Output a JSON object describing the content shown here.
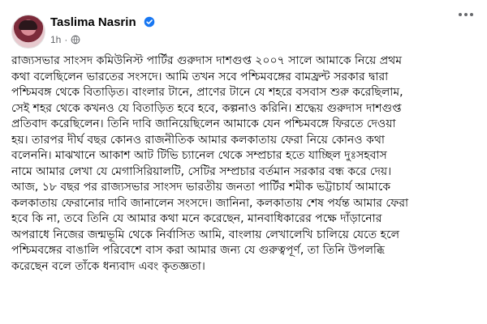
{
  "post": {
    "author_name": "Taslima Nasrin",
    "verified_badge": "verified-badge-icon",
    "timestamp": "1h",
    "privacy_icon": "globe-icon",
    "menu_icon": "more-options-icon",
    "lines": [
      "রাজ্যসভার সাংসদ কমিউনিস্ট পার্টির গুরুদাস দাশগুপ্ত  ২০০৭ সালে আমাকে নিয়ে প্রথম",
      "কথা বলেছিলেন ভারতের সংসদে। আমি তখন  সবে পশ্চিমবঙ্গের  বামফ্রন্ট সরকার দ্বারা",
      "পশ্চিমবঙ্গ থেকে বিতাড়িত। বাংলার টানে, প্রাণের টানে যে শহরে বসবাস শুরু করেছিলাম,",
      "সেই শহর থেকে কখনও যে বিতাড়িত হবে হবে, কল্পনাও করিনি। শ্রদ্ধেয় গুরুদাস দাশগুপ্ত",
      "প্রতিবাদ করেছিলেন। তিনি দাবি জানিয়েছিলেন আমাকে যেন পশ্চিমবঙ্গে ফিরতে দেওয়া",
      "হয়। তারপর দীর্ঘ বছর কোনও রাজনীতিক আমার কলকাতায় ফেরা নিয়ে কোনও কথা",
      "বলেননি। মাঝখানে  আকাশ আট টিভি চ্যানেল থেকে সম্প্রচার হতে যাচ্ছিল   দুঃসহবাস",
      "নামে আমার লেখা যে মেগাসিরিয়ালটি, সেটির সম্প্রচার  বর্তমান সরকার বন্ধ করে দেয়।",
      "আজ, ১৮ বছর পর রাজ্যসভার সাংসদ ভারতীয় জনতা পার্টির শমীক ভট্টাচার্য  আমাকে",
      "কলকাতায় ফেরানোর দাবি জানালেন সংসদে। জানিনা, কলকাতায় শেষ পর্যন্ত আমার ফেরা",
      "হবে কি   না, তবে তিনি যে আমার কথা মনে করেছেন, মানবাধিকারের পক্ষে দাঁড়ানোর",
      "অপরাধে নিজের জন্মভূমি  থেকে নির্বাসিত আমি, বাংলায় লেখালেখি চালিয়ে যেতে হলে",
      "পশ্চিমবঙ্গের বাঙালি পরিবেশে বাস করা আমার জন্য যে গুরুত্বপূর্ণ,  তা তিনি উপলব্ধি",
      "করেছেন বলে তাঁকে ধন্যবাদ এবং কৃতজ্ঞতা।"
    ]
  },
  "colors": {
    "text": "#050505",
    "secondary_text": "#65676b",
    "verified_blue": "#1877f2",
    "background": "#ffffff"
  }
}
